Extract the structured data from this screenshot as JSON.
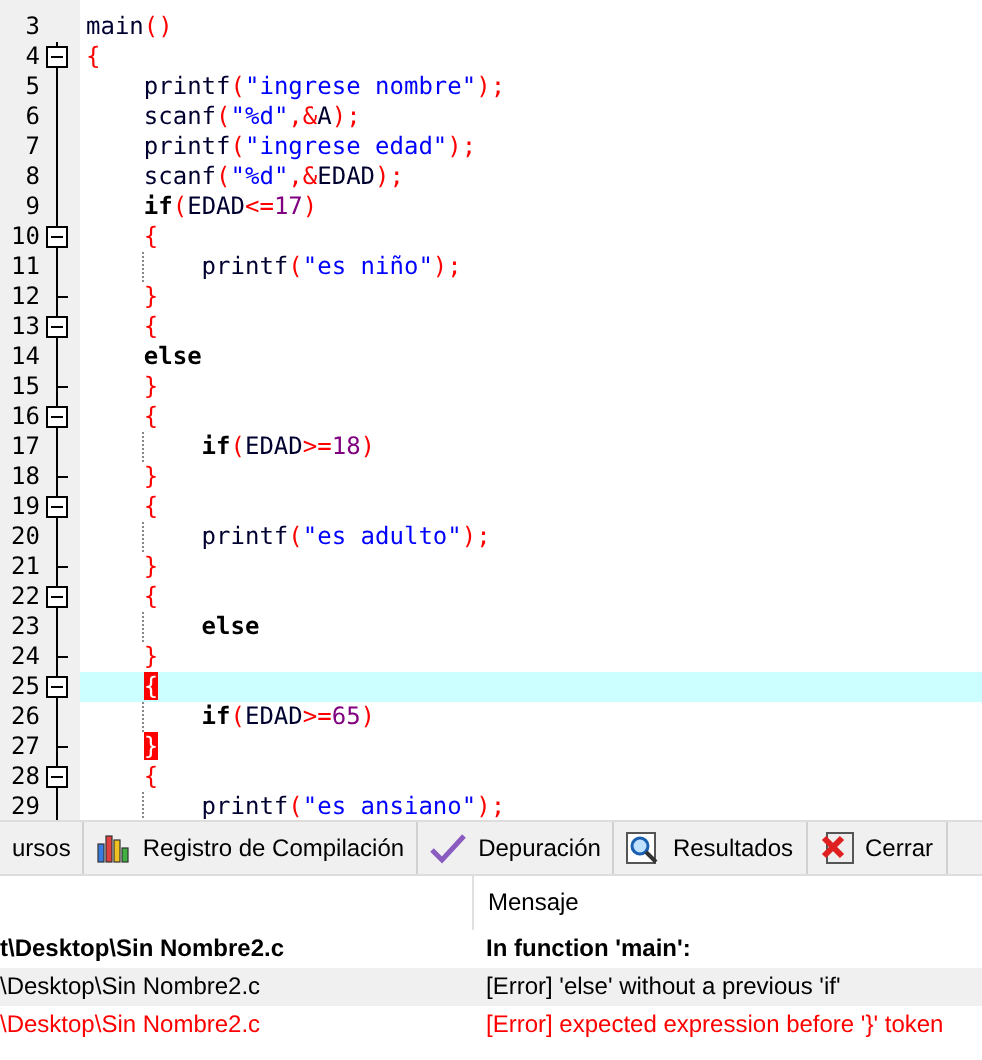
{
  "editor": {
    "lines": [
      {
        "number": "3",
        "kind": "plain",
        "highlighted": false,
        "guide": false,
        "tokens": [
          {
            "kind": "ident",
            "text": "main"
          },
          {
            "kind": "symbol",
            "text": "()"
          }
        ]
      },
      {
        "number": "4",
        "kind": "fold-box",
        "highlighted": false,
        "guide": false,
        "tokens": [
          {
            "kind": "symbol",
            "text": "{"
          }
        ]
      },
      {
        "number": "5",
        "kind": "fold-line",
        "highlighted": false,
        "guide": false,
        "tokens": [
          {
            "kind": "ident",
            "text": "    printf"
          },
          {
            "kind": "symbol",
            "text": "("
          },
          {
            "kind": "string",
            "text": "\"ingrese nombre\""
          },
          {
            "kind": "symbol",
            "text": ");"
          }
        ]
      },
      {
        "number": "6",
        "kind": "fold-line",
        "highlighted": false,
        "guide": false,
        "tokens": [
          {
            "kind": "ident",
            "text": "    scanf"
          },
          {
            "kind": "symbol",
            "text": "("
          },
          {
            "kind": "string",
            "text": "\"%d\""
          },
          {
            "kind": "symbol",
            "text": ",&"
          },
          {
            "kind": "ident",
            "text": "A"
          },
          {
            "kind": "symbol",
            "text": ");"
          }
        ]
      },
      {
        "number": "7",
        "kind": "fold-line",
        "highlighted": false,
        "guide": false,
        "tokens": [
          {
            "kind": "ident",
            "text": "    printf"
          },
          {
            "kind": "symbol",
            "text": "("
          },
          {
            "kind": "string",
            "text": "\"ingrese edad\""
          },
          {
            "kind": "symbol",
            "text": ");"
          }
        ]
      },
      {
        "number": "8",
        "kind": "fold-line",
        "highlighted": false,
        "guide": false,
        "tokens": [
          {
            "kind": "ident",
            "text": "    scanf"
          },
          {
            "kind": "symbol",
            "text": "("
          },
          {
            "kind": "string",
            "text": "\"%d\""
          },
          {
            "kind": "symbol",
            "text": ",&"
          },
          {
            "kind": "ident",
            "text": "EDAD"
          },
          {
            "kind": "symbol",
            "text": ");"
          }
        ]
      },
      {
        "number": "9",
        "kind": "fold-line",
        "highlighted": false,
        "guide": false,
        "tokens": [
          {
            "kind": "keyword",
            "text": "    if"
          },
          {
            "kind": "symbol",
            "text": "("
          },
          {
            "kind": "ident",
            "text": "EDAD"
          },
          {
            "kind": "symbol",
            "text": "<="
          },
          {
            "kind": "number",
            "text": "17"
          },
          {
            "kind": "symbol",
            "text": ")"
          }
        ]
      },
      {
        "number": "10",
        "kind": "fold-box",
        "highlighted": false,
        "guide": false,
        "tokens": [
          {
            "kind": "symbol",
            "text": "    {"
          }
        ]
      },
      {
        "number": "11",
        "kind": "fold-line",
        "highlighted": false,
        "guide": true,
        "tokens": [
          {
            "kind": "ident",
            "text": "        printf"
          },
          {
            "kind": "symbol",
            "text": "("
          },
          {
            "kind": "string",
            "text": "\"es niño\""
          },
          {
            "kind": "symbol",
            "text": ");"
          }
        ]
      },
      {
        "number": "12",
        "kind": "fold-end",
        "highlighted": false,
        "guide": false,
        "tokens": [
          {
            "kind": "symbol",
            "text": "    }"
          }
        ]
      },
      {
        "number": "13",
        "kind": "fold-box",
        "highlighted": false,
        "guide": false,
        "tokens": [
          {
            "kind": "symbol",
            "text": "    {"
          }
        ]
      },
      {
        "number": "14",
        "kind": "fold-line",
        "highlighted": false,
        "guide": false,
        "tokens": [
          {
            "kind": "keyword",
            "text": "    else"
          }
        ]
      },
      {
        "number": "15",
        "kind": "fold-end",
        "highlighted": false,
        "guide": false,
        "tokens": [
          {
            "kind": "symbol",
            "text": "    }"
          }
        ]
      },
      {
        "number": "16",
        "kind": "fold-box",
        "highlighted": false,
        "guide": false,
        "tokens": [
          {
            "kind": "symbol",
            "text": "    {"
          }
        ]
      },
      {
        "number": "17",
        "kind": "fold-line",
        "highlighted": false,
        "guide": true,
        "tokens": [
          {
            "kind": "keyword",
            "text": "        if"
          },
          {
            "kind": "symbol",
            "text": "("
          },
          {
            "kind": "ident",
            "text": "EDAD"
          },
          {
            "kind": "symbol",
            "text": ">="
          },
          {
            "kind": "number",
            "text": "18"
          },
          {
            "kind": "symbol",
            "text": ")"
          }
        ]
      },
      {
        "number": "18",
        "kind": "fold-end",
        "highlighted": false,
        "guide": false,
        "tokens": [
          {
            "kind": "symbol",
            "text": "    }"
          }
        ]
      },
      {
        "number": "19",
        "kind": "fold-box",
        "highlighted": false,
        "guide": false,
        "tokens": [
          {
            "kind": "symbol",
            "text": "    {"
          }
        ]
      },
      {
        "number": "20",
        "kind": "fold-line",
        "highlighted": false,
        "guide": true,
        "tokens": [
          {
            "kind": "ident",
            "text": "        printf"
          },
          {
            "kind": "symbol",
            "text": "("
          },
          {
            "kind": "string",
            "text": "\"es adulto\""
          },
          {
            "kind": "symbol",
            "text": ");"
          }
        ]
      },
      {
        "number": "21",
        "kind": "fold-end",
        "highlighted": false,
        "guide": false,
        "tokens": [
          {
            "kind": "symbol",
            "text": "    }"
          }
        ]
      },
      {
        "number": "22",
        "kind": "fold-box",
        "highlighted": false,
        "guide": false,
        "tokens": [
          {
            "kind": "symbol",
            "text": "    {"
          }
        ]
      },
      {
        "number": "23",
        "kind": "fold-line",
        "highlighted": false,
        "guide": true,
        "tokens": [
          {
            "kind": "keyword",
            "text": "        else"
          }
        ]
      },
      {
        "number": "24",
        "kind": "fold-end",
        "highlighted": false,
        "guide": false,
        "tokens": [
          {
            "kind": "symbol",
            "text": "    }"
          }
        ]
      },
      {
        "number": "25",
        "kind": "fold-box",
        "highlighted": true,
        "guide": false,
        "tokens": [
          {
            "kind": "match",
            "text": "    {"
          }
        ]
      },
      {
        "number": "26",
        "kind": "fold-line",
        "highlighted": false,
        "guide": true,
        "tokens": [
          {
            "kind": "keyword",
            "text": "        if"
          },
          {
            "kind": "symbol",
            "text": "("
          },
          {
            "kind": "ident",
            "text": "EDAD"
          },
          {
            "kind": "symbol",
            "text": ">="
          },
          {
            "kind": "number",
            "text": "65"
          },
          {
            "kind": "symbol",
            "text": ")"
          }
        ]
      },
      {
        "number": "27",
        "kind": "fold-end",
        "highlighted": false,
        "guide": false,
        "tokens": [
          {
            "kind": "match",
            "text": "    }"
          }
        ]
      },
      {
        "number": "28",
        "kind": "fold-box",
        "highlighted": false,
        "guide": false,
        "tokens": [
          {
            "kind": "symbol",
            "text": "    {"
          }
        ]
      },
      {
        "number": "29",
        "kind": "fold-line",
        "highlighted": false,
        "guide": true,
        "tokens": [
          {
            "kind": "ident",
            "text": "        printf"
          },
          {
            "kind": "symbol",
            "text": "("
          },
          {
            "kind": "string",
            "text": "\"es ansiano\""
          },
          {
            "kind": "symbol",
            "text": ");"
          }
        ]
      }
    ]
  },
  "tabs": [
    {
      "kind": "none",
      "label": "ursos"
    },
    {
      "kind": "chart",
      "label": "Registro de Compilación"
    },
    {
      "kind": "check",
      "label": "Depuración"
    },
    {
      "kind": "search",
      "label": "Resultados"
    },
    {
      "kind": "close",
      "label": "Cerrar"
    }
  ],
  "messages": {
    "columns": [
      "Mensaje"
    ],
    "rows": [
      {
        "kind": "header",
        "selected": false,
        "file": "t\\Desktop\\Sin Nombre2.c",
        "message": "In function 'main':"
      },
      {
        "kind": "normal",
        "selected": true,
        "file": "\\Desktop\\Sin Nombre2.c",
        "message": "[Error] 'else' without a previous 'if'"
      },
      {
        "kind": "error",
        "selected": false,
        "file": "\\Desktop\\Sin Nombre2.c",
        "message": "[Error] expected expression before '}' token"
      }
    ]
  }
}
